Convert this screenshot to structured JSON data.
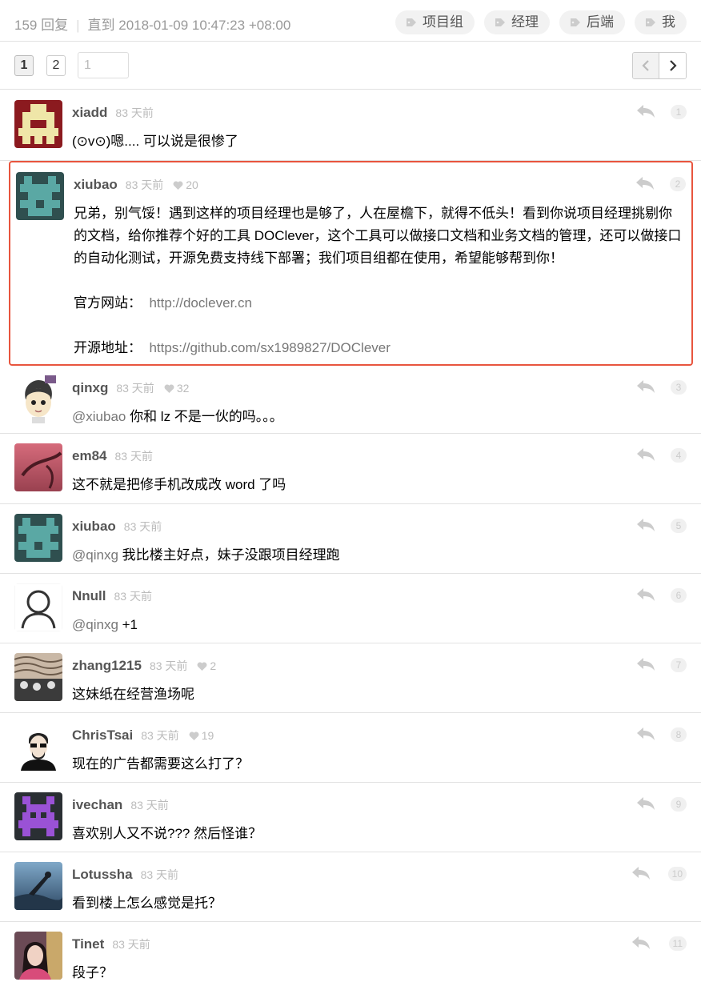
{
  "header": {
    "reply_count": "159 回复",
    "last_reply": "直到 2018-01-09 10:47:23 +08:00",
    "tags": [
      "项目组",
      "经理",
      "后端",
      "我"
    ]
  },
  "pager": {
    "pages": [
      "1",
      "2"
    ],
    "current": "1",
    "input_placeholder": "1"
  },
  "colors": {
    "highlight": "#e8553e",
    "username": "#555555",
    "meta": "#bbbbbb"
  },
  "replies": [
    {
      "user": "xiadd",
      "ago": "83 天前",
      "likes": "",
      "floor": "1",
      "text": "(⊙v⊙)嗯.... 可以说是很惨了"
    },
    {
      "user": "xiubao",
      "ago": "83 天前",
      "likes": "20",
      "floor": "2",
      "text": "兄弟，别气馁！遇到这样的项目经理也是够了，人在屋檐下，就得不低头！看到你说项目经理挑剔你的文档，给你推荐个好的工具 DOClever，这个工具可以做接口文档和业务文档的管理，还可以做接口的自动化测试，开源免费支持线下部署；我们项目组都在使用，希望能够帮到你！",
      "site_label": "官方网站：",
      "site_url": "http://doclever.cn",
      "repo_label": "开源地址：",
      "repo_url": "https://github.com/sx1989827/DOClever"
    },
    {
      "user": "qinxg",
      "ago": "83 天前",
      "likes": "32",
      "floor": "3",
      "mention": "@xiubao",
      "text": " 你和 lz 不是一伙的吗。。。"
    },
    {
      "user": "em84",
      "ago": "83 天前",
      "likes": "",
      "floor": "4",
      "text": "这不就是把修手机改成改 word 了吗"
    },
    {
      "user": "xiubao",
      "ago": "83 天前",
      "likes": "",
      "floor": "5",
      "mention": "@qinxg",
      "text": " 我比楼主好点，妹子没跟项目经理跑"
    },
    {
      "user": "Nnull",
      "ago": "83 天前",
      "likes": "",
      "floor": "6",
      "mention": "@qinxg",
      "text": " +1"
    },
    {
      "user": "zhang1215",
      "ago": "83 天前",
      "likes": "2",
      "floor": "7",
      "text": "这妹纸在经营渔场呢"
    },
    {
      "user": "ChrisTsai",
      "ago": "83 天前",
      "likes": "19",
      "floor": "8",
      "text": "现在的广告都需要这么打了？"
    },
    {
      "user": "ivechan",
      "ago": "83 天前",
      "likes": "",
      "floor": "9",
      "text": "喜欢别人又不说??? 然后怪谁？"
    },
    {
      "user": "Lotussha",
      "ago": "83 天前",
      "likes": "",
      "floor": "10",
      "text": "看到楼上怎么感觉是托？"
    },
    {
      "user": "Tinet",
      "ago": "83 天前",
      "likes": "",
      "floor": "11",
      "text": "段子？"
    }
  ]
}
